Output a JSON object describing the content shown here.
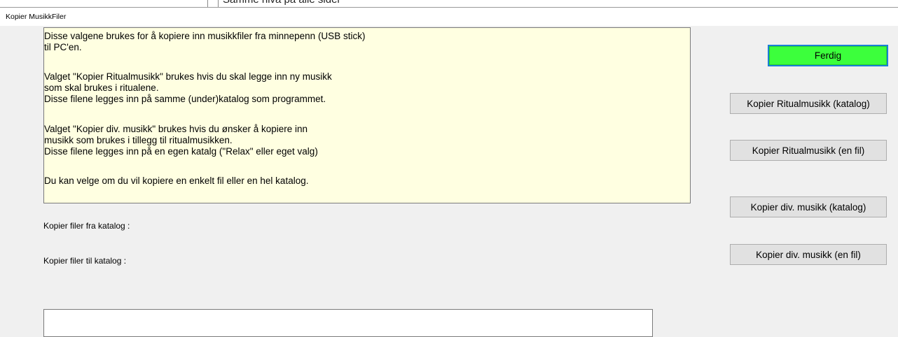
{
  "background_window": {
    "partial_text": "Samme nivå på alle sider"
  },
  "window": {
    "title": "Kopier MusikkFiler"
  },
  "info_panel": {
    "lines": [
      "Disse valgene brukes for å kopiere inn musikkfiler fra minnepenn (USB stick)",
      "til PC'en.",
      "Valget \"Kopier Ritualmusikk\" brukes hvis du skal legge inn ny musikk",
      "som skal brukes i ritualene.",
      "Disse filene legges inn på samme (under)katalog som programmet.",
      "Valget \"Kopier div. musikk\" brukes hvis du ønsker å kopiere inn",
      "musikk som brukes i tillegg til ritualmusikken.",
      "Disse filene legges inn på en egen katalg (\"Relax\" eller eget valg)",
      "Du kan velge om du vil kopiere en enkelt fil eller en hel katalog."
    ]
  },
  "labels": {
    "from_dir": "Kopier filer fra katalog :",
    "to_dir": "Kopier filer til katalog :"
  },
  "buttons": {
    "done": "Ferdig",
    "ritual_dir": "Kopier Ritualmusikk (katalog)",
    "ritual_file": "Kopier Ritualmusikk (en fil)",
    "misc_dir": "Kopier div. musikk (katalog)",
    "misc_file": "Kopier div. musikk (en fil)"
  },
  "colors": {
    "info_panel_bg": "#ffffe1",
    "done_button_bg": "#3cff3c",
    "done_button_border": "#1a7fd6",
    "button_bg": "#e1e1e1",
    "window_bg": "#f0f0f0"
  }
}
